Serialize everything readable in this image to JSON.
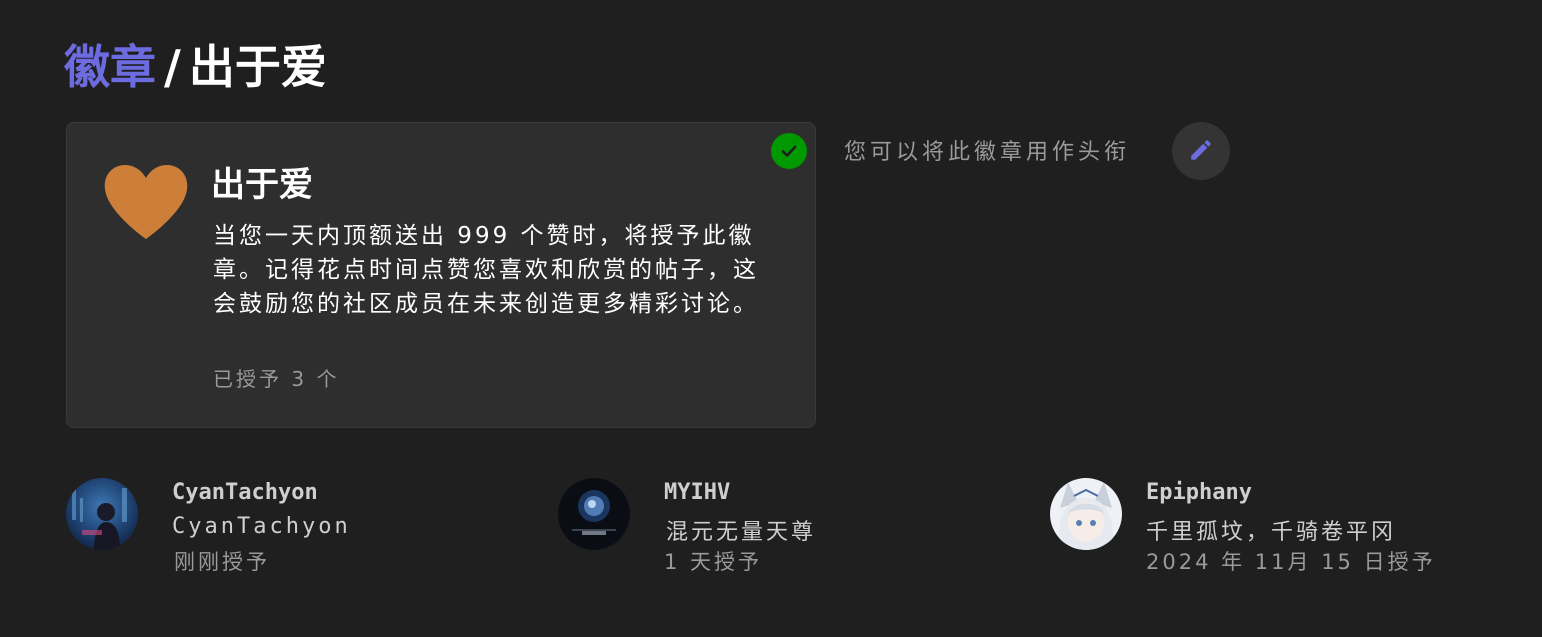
{
  "breadcrumb": {
    "parent_label": "徽章",
    "separator": "/",
    "current_label": "出于爱"
  },
  "badge": {
    "name": "出于爱",
    "description": "当您一天内顶额送出 999 个赞时，将授予此徽章。记得花点时间点赞您喜欢和欣赏的帖子，这会鼓励您的社区成员在未来创造更多精彩讨论。",
    "granted_count": "已授予 3 个",
    "icon": "heart-icon",
    "icon_color": "#cd7f3a",
    "owned": true,
    "owned_color": "#009900"
  },
  "title_usage": {
    "text": "您可以将此徽章用作头衔",
    "edit_icon": "pencil-icon"
  },
  "accent_color": "#6d6be0",
  "users": [
    {
      "username": "CyanTachyon",
      "title": "CyanTachyon",
      "granted": "刚刚授予"
    },
    {
      "username": "MYIHV",
      "title": "混元无量天尊",
      "granted": "1 天授予"
    },
    {
      "username": "Epiphany",
      "title": "千里孤坟，千骑卷平冈",
      "granted": "2024 年 11月 15 日授予"
    }
  ]
}
